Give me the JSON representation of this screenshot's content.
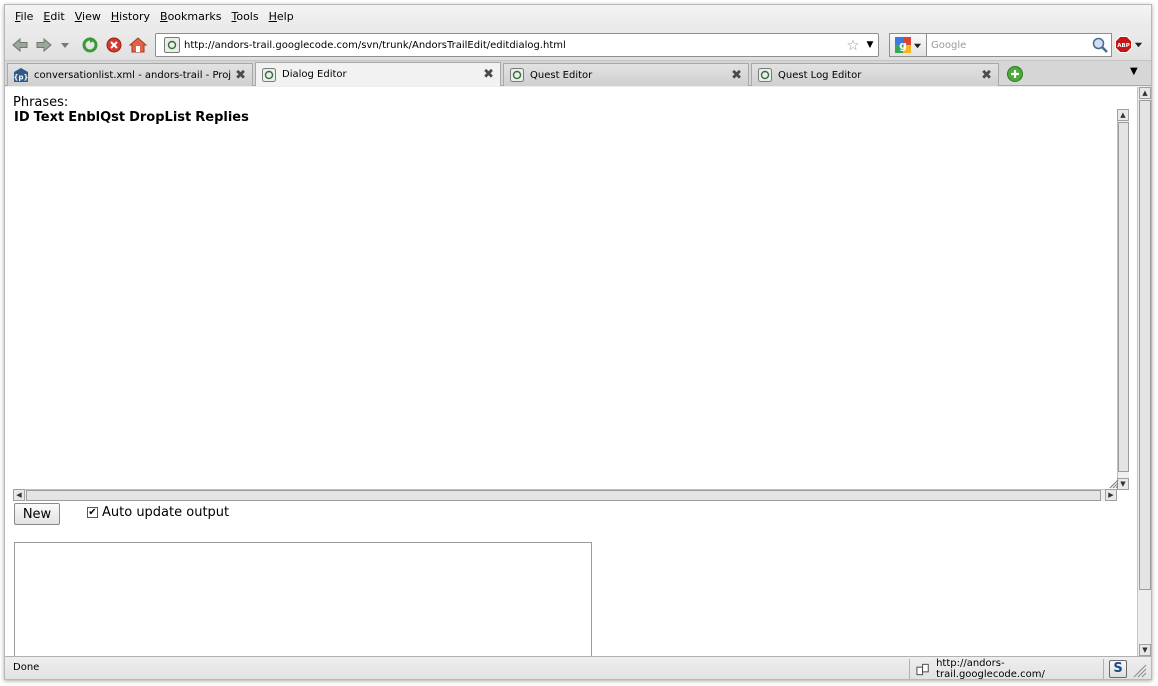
{
  "menu": [
    "File",
    "Edit",
    "View",
    "History",
    "Bookmarks",
    "Tools",
    "Help"
  ],
  "navbar": {
    "url": "http://andors-trail.googlecode.com/svn/trunk/AndorsTrailEdit/editdialog.html",
    "search_placeholder": "Google",
    "abp_label": "ABP"
  },
  "tabs": [
    {
      "label": "conversationlist.xml - andors-trail - Projec...",
      "active": false
    },
    {
      "label": "Dialog Editor",
      "active": true
    },
    {
      "label": "Quest Editor",
      "active": false
    },
    {
      "label": "Quest Log Editor",
      "active": false
    }
  ],
  "content": {
    "phrases_label": "Phrases:",
    "columns": [
      "ID",
      "Text",
      "EnblQst",
      "DropList",
      "Replies"
    ],
    "new_button": "New",
    "auto_update_label": "Auto update output",
    "auto_update_checked": true
  },
  "status": {
    "text": "Done",
    "url": "http://andors-trail.googlecode.com/",
    "s_button": "S"
  },
  "colors": {
    "accent_green": "#3a9a3a",
    "stop_red": "#d23b2b",
    "abp_red": "#c81414"
  }
}
